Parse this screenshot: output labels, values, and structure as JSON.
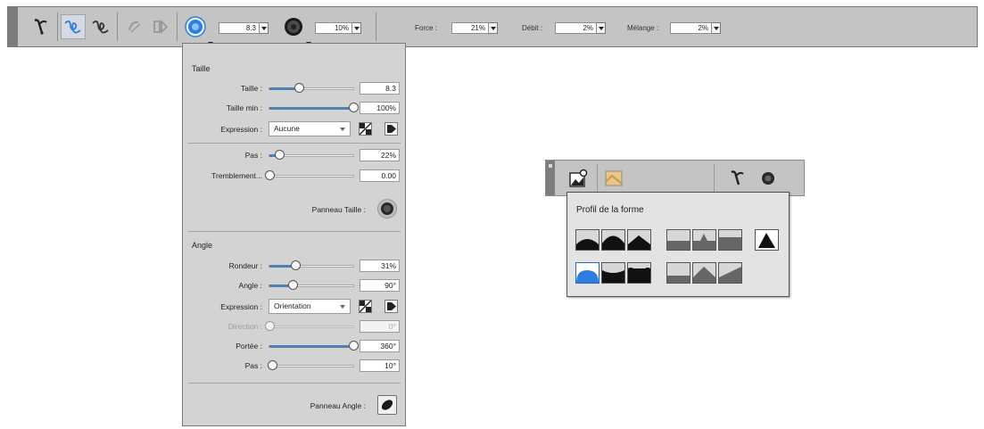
{
  "toolbar": {
    "size_value": "8.3",
    "opacity_value": "10%",
    "force_label": "Force :",
    "force_value": "21%",
    "debit_label": "Débit :",
    "debit_value": "2%",
    "melange_label": "Mélange :",
    "melange_value": "2%"
  },
  "brush_panel": {
    "taille_section": "Taille",
    "taille_label": "Taille :",
    "taille_value": "8.3",
    "taille_fraction": 0.35,
    "taille_min_label": "Taille min :",
    "taille_min_value": "100%",
    "taille_min_fraction": 1.0,
    "expression_label": "Expression :",
    "expression_value": "Aucune",
    "pas_label": "Pas :",
    "pas_value": "22%",
    "pas_fraction": 0.12,
    "tremblement_label": "Tremblement...",
    "tremblement_value": "0.00",
    "tremblement_fraction": 0.0,
    "panneau_taille_label": "Panneau Taille :",
    "angle_section": "Angle",
    "rondeur_label": "Rondeur :",
    "rondeur_value": "31%",
    "rondeur_fraction": 0.31,
    "angle_label": "Angle :",
    "angle_value": "90°",
    "angle_fraction": 0.28,
    "expression2_label": "Expression :",
    "expression2_value": "Orientation",
    "direction_label": "Direction :",
    "direction_value": "0°",
    "direction_fraction": 0.0,
    "portee_label": "Portée :",
    "portee_value": "360°",
    "portee_fraction": 1.0,
    "pas2_label": "Pas :",
    "pas2_value": "10°",
    "pas2_fraction": 0.03,
    "panneau_angle_label": "Panneau Angle :"
  },
  "profile_flyout": {
    "title": "Profil de la forme"
  },
  "colors": {
    "accent": "#2e7de0",
    "panel_bg": "#d3d3d3",
    "toolbar_bg": "#c4c4c4",
    "slider_fill": "#4f7fb3"
  }
}
